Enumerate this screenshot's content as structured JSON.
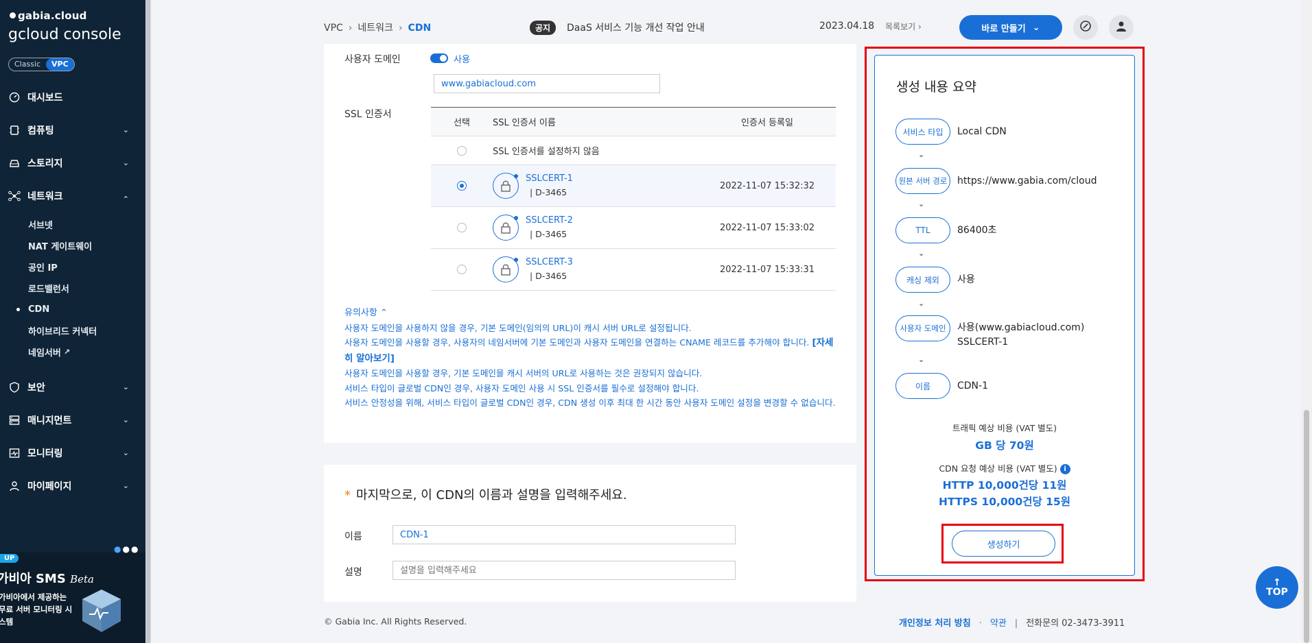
{
  "sidebar": {
    "brand": "gabia.cloud",
    "console": "gcloud console",
    "env": {
      "classic": "Classic",
      "vpc": "VPC"
    },
    "items": [
      {
        "label": "대시보드",
        "icon": "gauge-icon"
      },
      {
        "label": "컴퓨팅",
        "icon": "chip-icon"
      },
      {
        "label": "스토리지",
        "icon": "drive-icon"
      },
      {
        "label": "네트워크",
        "icon": "network-icon"
      },
      {
        "label": "보안",
        "icon": "shield-icon"
      },
      {
        "label": "매니지먼트",
        "icon": "management-icon"
      },
      {
        "label": "모니터링",
        "icon": "monitor-icon"
      },
      {
        "label": "마이페이지",
        "icon": "user-icon"
      }
    ],
    "network_sub": [
      "서브넷",
      "NAT 게이트웨이",
      "공인 IP",
      "로드밸런서",
      "CDN",
      "하이브리드 커넥터",
      "네임서버"
    ],
    "banner": {
      "badge": "UP",
      "title": "가비아 SMS",
      "beta": "Beta",
      "desc": "가비아에서 제공하는 무료 서버 모니터링 시스템"
    }
  },
  "header": {
    "breadcrumb": [
      "VPC",
      "네트워크",
      "CDN"
    ],
    "notice_badge": "공지",
    "notice_text": "DaaS 서비스 기능 개선 작업 안내",
    "notice_date": "2023.04.18",
    "notice_more": "목록보기",
    "create_button": "바로 만들기"
  },
  "domain": {
    "label": "사용자 도메인",
    "toggle_label": "사용",
    "value": "www.gabiacloud.com"
  },
  "ssl": {
    "label": "SSL 인증서",
    "columns": [
      "선택",
      "SSL 인증서 이름",
      "인증서 등록일"
    ],
    "none_option": "SSL 인증서를 설정하지 않음",
    "rows": [
      {
        "name": "SSLCERT-1",
        "sub": "|  D-3465",
        "date": "2022-11-07 15:32:32",
        "selected": true
      },
      {
        "name": "SSLCERT-2",
        "sub": "|  D-3465",
        "date": "2022-11-07 15:33:02",
        "selected": false
      },
      {
        "name": "SSLCERT-3",
        "sub": "|  D-3465",
        "date": "2022-11-07 15:33:31",
        "selected": false
      }
    ]
  },
  "notes": {
    "title": "유의사항",
    "line1": "사용자 도메인을 사용하지 않을 경우, 기본 도메인(임의의 URL)이 캐시 서버 URL로 설정됩니다.",
    "line2": "사용자 도메인을 사용할 경우, 사용자의 네임서버에 기본 도메인과 사용자 도메인을 연결하는 CNAME 레코드를 추가해야 합니다.",
    "link": "[자세히 알아보기]",
    "line3": "사용자 도메인을 사용할 경우, 기본 도메인을 캐시 서버의 URL로 사용하는 것은 권장되지 않습니다.",
    "line4": "서비스 타입이 글로벌 CDN인 경우, 사용자 도메인 사용 시 SSL 인증서를 필수로 설정해야 합니다.",
    "line5": "서비스 안정성을 위해, 서비스 타입이 글로벌 CDN인 경우, CDN 생성 이후 최대 한 시간 동안 사용자 도메인 설정을 변경할 수 없습니다."
  },
  "name_section": {
    "required_mark": "*",
    "title": "마지막으로, 이 CDN의 이름과 설명을 입력해주세요.",
    "name_label": "이름",
    "name_value": "CDN-1",
    "desc_label": "설명",
    "desc_placeholder": "설명을 입력해주세요"
  },
  "footer": {
    "copyright": "© Gabia Inc. All Rights Reserved.",
    "privacy": "개인정보 처리 방침",
    "terms": "약관",
    "phone": "전화문의  02-3473-3911"
  },
  "summary": {
    "title": "생성 내용 요약",
    "steps": [
      {
        "label": "서비스 타입",
        "value": "Local CDN"
      },
      {
        "label": "원본 서버 경로",
        "value": "https://www.gabia.com/cloud"
      },
      {
        "label": "TTL",
        "value": "86400초"
      },
      {
        "label": "캐싱 제외",
        "value": "사용"
      },
      {
        "label": "사용자 도메인",
        "value": "사용(www.gabiacloud.com)",
        "value2": "SSLCERT-1"
      },
      {
        "label": "이름",
        "value": "CDN-1"
      }
    ],
    "traffic_label": "트래픽 예상 비용 (VAT 별도)",
    "traffic_value": "GB 당 70원",
    "request_label": "CDN 요청 예상 비용 (VAT 별도)",
    "http_value": "HTTP 10,000건당 11원",
    "https_value": "HTTPS 10,000건당 15원",
    "submit": "생성하기"
  },
  "top_button": "TOP"
}
